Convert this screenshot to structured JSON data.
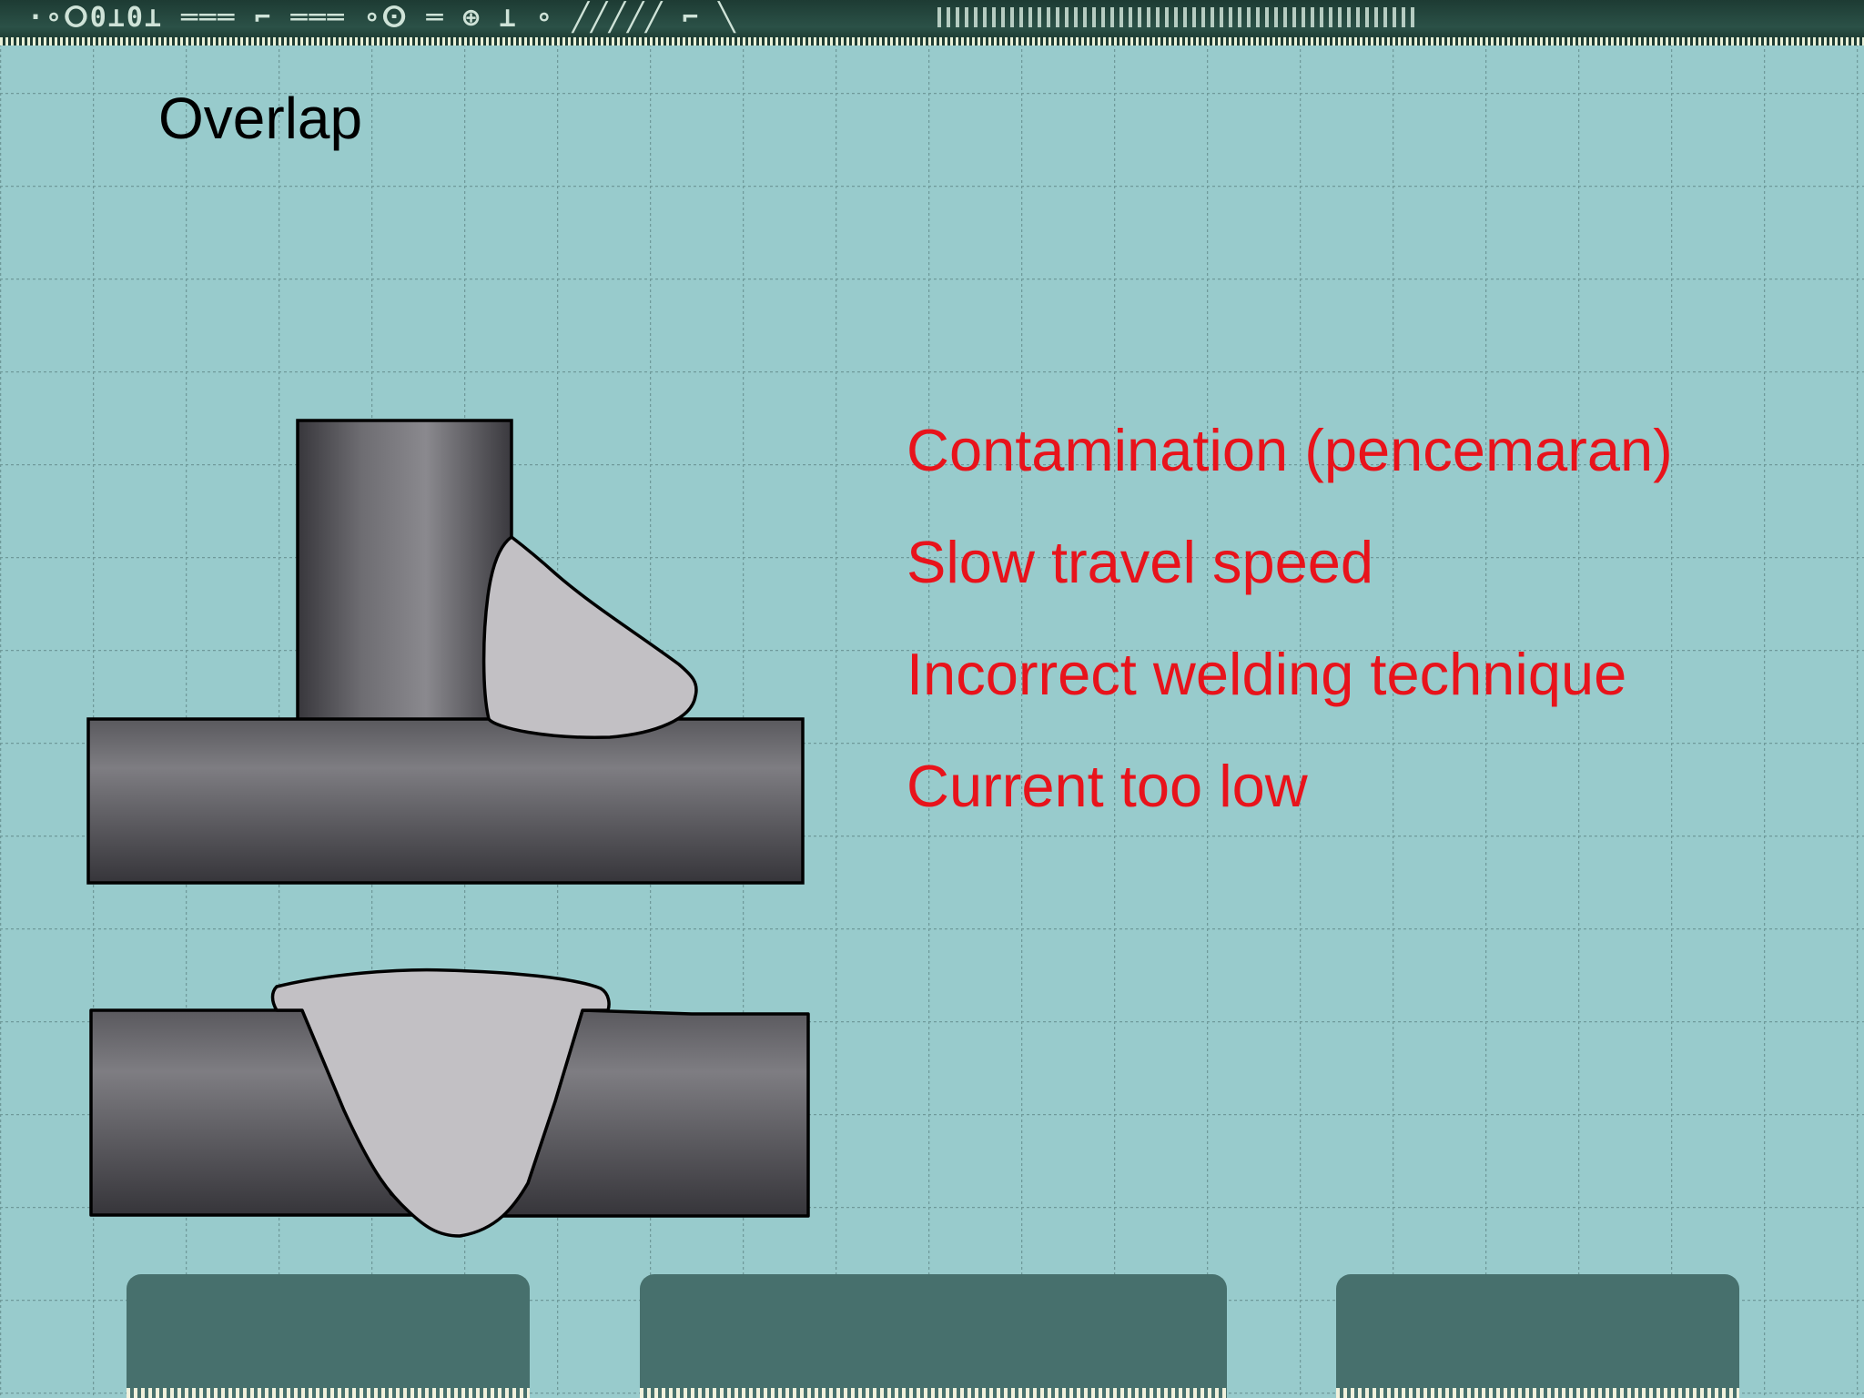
{
  "slide": {
    "title": "Overlap",
    "causes": [
      "Contamination (pencemaran)",
      "Slow travel speed",
      "Incorrect welding technique",
      "Current too low"
    ]
  },
  "colors": {
    "background": "#98cbcc",
    "grid_line": "#6f9a9a",
    "cause_text": "#e8131b",
    "title_text": "#000000",
    "weld_metal": "#c2c0c4",
    "base_metal_light": "#7c7b80",
    "base_metal_dark": "#3c3b40",
    "banner": "#1d3b33",
    "bottom_pads": "#47706d"
  },
  "decorations": {
    "top_banner": "circuit-board-banner",
    "bottom_pads": "circuit-contact-pads"
  }
}
